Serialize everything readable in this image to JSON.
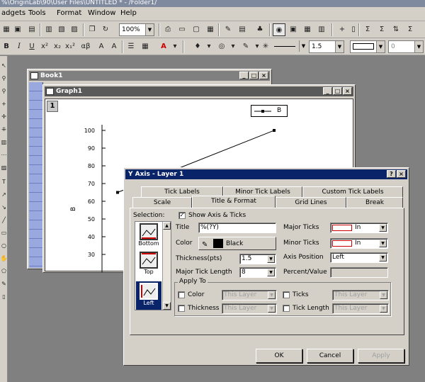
{
  "app_title": "%\\OriginLab\\90\\User Files\\UNTITLED * - /Folder1/",
  "menu": [
    "adgets",
    "Tools",
    "Format",
    "Window",
    "Help"
  ],
  "toolbar1": {
    "zoom": "100%"
  },
  "toolbar2": {
    "thickness": "1.5",
    "value2": "0"
  },
  "book_window": {
    "title": "Book1"
  },
  "graph_window": {
    "title": "Graph1",
    "layer_number": "1",
    "legend_text": "B",
    "y_axis_label": "B",
    "y_ticks": [
      "100",
      "90",
      "80",
      "70",
      "60",
      "50",
      "40",
      "30"
    ],
    "x_tick": "1"
  },
  "chart_data": {
    "type": "line",
    "ylabel": "B",
    "ylim": [
      25,
      105
    ],
    "x_tick_labels": [
      "1"
    ],
    "series": [
      {
        "name": "B",
        "points": [
          {
            "x": 1,
            "y": 65
          },
          {
            "x": 2,
            "y": 100
          }
        ]
      }
    ]
  },
  "dialog": {
    "title": "Y Axis - Layer 1",
    "tabs_row1": [
      "Tick Labels",
      "Minor Tick Labels",
      "Custom Tick Labels"
    ],
    "tabs_row2": [
      "Scale",
      "Title & Format",
      "Grid Lines",
      "Break"
    ],
    "selection_label": "Selection:",
    "selection_items": [
      "Bottom",
      "Top",
      "Left"
    ],
    "show_axis_label": "Show Axis & Ticks",
    "title_label": "Title",
    "title_value": "%(?Y)",
    "color_label": "Color",
    "color_value": "Black",
    "thickness_label": "Thickness(pts)",
    "thickness_value": "1.5",
    "major_tick_length_label": "Major Tick Length",
    "major_tick_length_value": "8",
    "major_ticks_label": "Major Ticks",
    "major_ticks_value": "In",
    "minor_ticks_label": "Minor Ticks",
    "minor_ticks_value": "In",
    "axis_position_label": "Axis Position",
    "axis_position_value": "Left",
    "percent_value_label": "Percent/Value",
    "apply_to_label": "Apply To",
    "apply_color": "Color",
    "apply_thickness": "Thickness",
    "apply_ticks": "Ticks",
    "apply_tick_length": "Tick Length",
    "this_layer": "This Layer",
    "ok": "OK",
    "cancel": "Cancel",
    "apply": "Apply",
    "help_btn": "?",
    "close_btn": "×"
  },
  "colors": {
    "active_title": "#0a246a",
    "inactive_title": "#808080",
    "face": "#d4d0c8",
    "curve": "#000000"
  }
}
